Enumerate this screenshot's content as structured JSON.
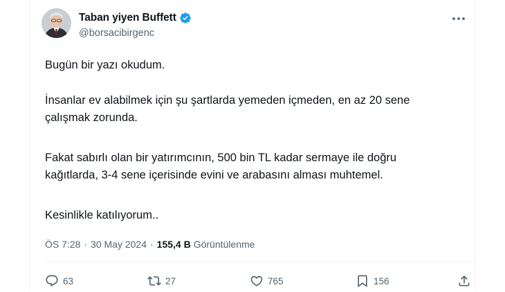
{
  "author": {
    "display_name": "Taban yiyen Buffett",
    "handle": "@borsacibirgenc",
    "verified": true,
    "avatar_icon": "profile-photo"
  },
  "tweet": {
    "paragraphs": [
      "Bugün bir yazı okudum.",
      "İnsanlar ev alabilmek için şu şartlarda yemeden içmeden, en az 20 sene\nçalışmak zorunda.",
      "Fakat sabırlı olan bir yatırımcının, 500 bin TL kadar sermaye ile doğru\nkağıtlarda, 3-4 sene içerisinde evini ve arabasını alması muhtemel.",
      "Kesinlikle katılıyorum.."
    ]
  },
  "meta": {
    "time": "ÖS 7:28",
    "separator": "·",
    "date": "30 May 2024",
    "views_count": "155,4 B",
    "views_label": "Görüntülenme"
  },
  "actions": {
    "reply_count": "63",
    "retweet_count": "27",
    "like_count": "765",
    "bookmark_count": "156"
  },
  "colors": {
    "text": "#0f1419",
    "secondary": "#536471",
    "verified": "#1d9bf0",
    "divider": "#eff3f4"
  }
}
